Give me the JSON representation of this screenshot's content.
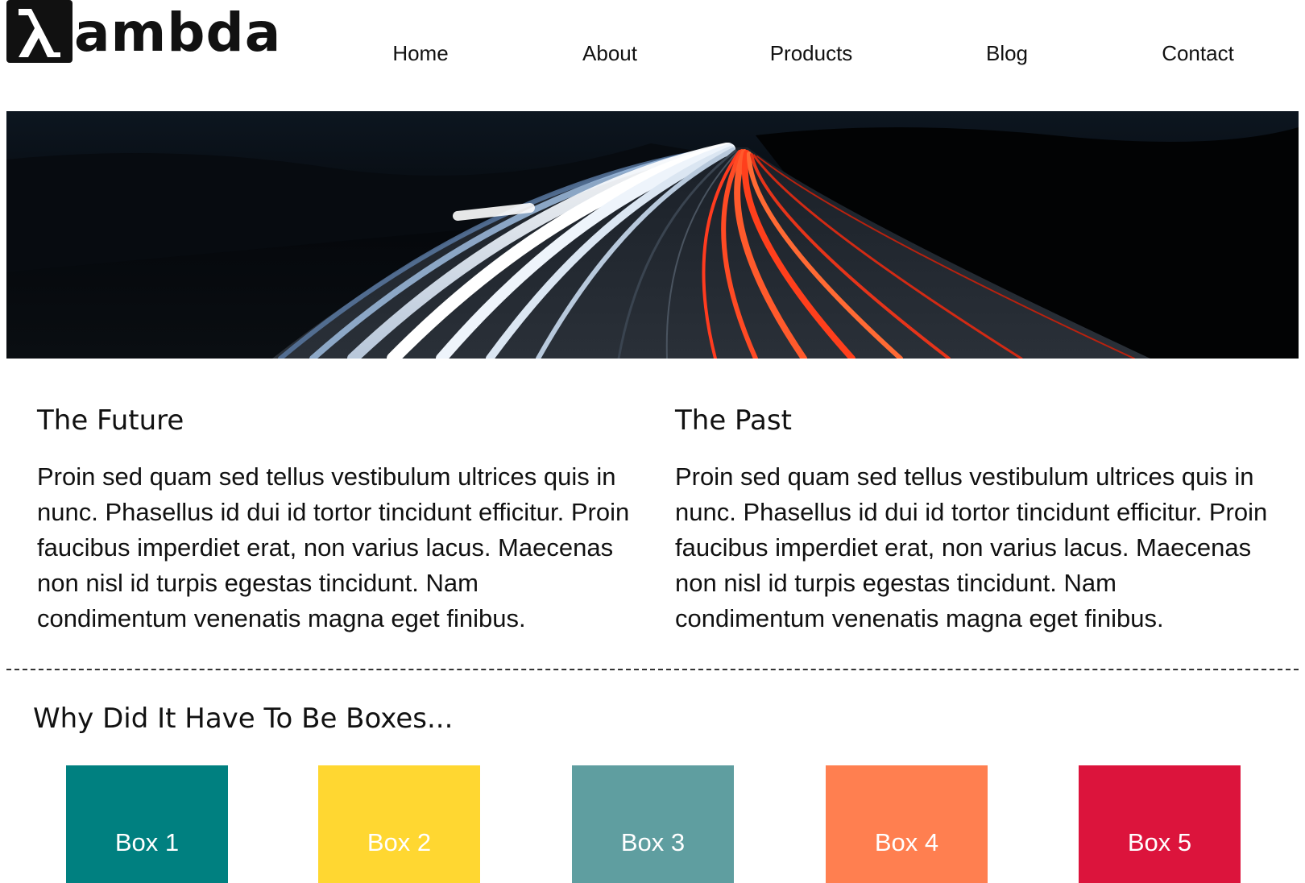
{
  "header": {
    "logo": {
      "icon": "lambda-icon",
      "text": "ambda"
    },
    "nav": [
      {
        "label": "Home"
      },
      {
        "label": "About"
      },
      {
        "label": "Products"
      },
      {
        "label": "Blog"
      },
      {
        "label": "Contact"
      }
    ]
  },
  "hero": {
    "image": "highway-light-trails-at-night"
  },
  "columns": [
    {
      "title": "The Future",
      "body": "Proin sed quam sed tellus vestibulum ultrices quis in nunc. Phasellus id dui id tortor tincidunt efficitur. Proin faucibus imperdiet erat, non varius lacus. Maecenas non nisl id turpis egestas tincidunt. Nam condimentum venenatis magna eget finibus."
    },
    {
      "title": "The Past",
      "body": "Proin sed quam sed tellus vestibulum ultrices quis in nunc. Phasellus id dui id tortor tincidunt efficitur. Proin faucibus imperdiet erat, non varius lacus. Maecenas non nisl id turpis egestas tincidunt. Nam condimentum venenatis magna eget finibus."
    }
  ],
  "boxes_section": {
    "title": "Why Did It Have To Be Boxes...",
    "boxes": [
      {
        "label": "Box 1",
        "color": "#008080"
      },
      {
        "label": "Box 2",
        "color": "#FFD731"
      },
      {
        "label": "Box 3",
        "color": "#5F9EA0"
      },
      {
        "label": "Box 4",
        "color": "#FF7F50"
      },
      {
        "label": "Box 5",
        "color": "#DC143C"
      }
    ]
  }
}
